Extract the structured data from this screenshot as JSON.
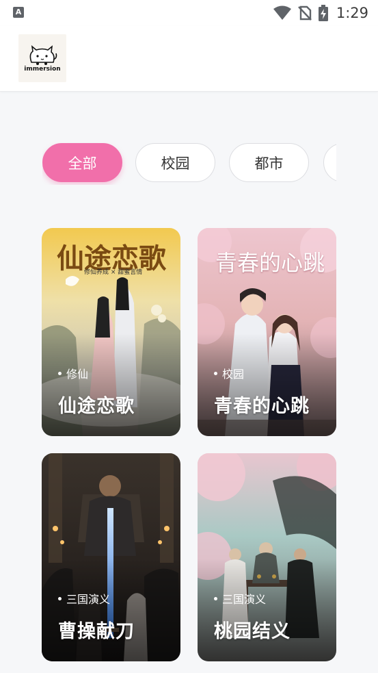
{
  "status_bar": {
    "app_icon_letter": "A",
    "time": "1:29"
  },
  "header": {
    "logo_text": "immersion"
  },
  "categories": [
    {
      "label": "全部",
      "active": true
    },
    {
      "label": "校园",
      "active": false
    },
    {
      "label": "都市",
      "active": false
    },
    {
      "label": "",
      "active": false
    }
  ],
  "stories": [
    {
      "tag": "修仙",
      "title": "仙途恋歌",
      "cover_title": "仙途恋歌",
      "cover_subtitle": "修仙养成 × 甜蜜言情"
    },
    {
      "tag": "校园",
      "title": "青春的心跳",
      "cover_title": "青春的心跳"
    },
    {
      "tag": "三国演义",
      "title": "曹操献刀"
    },
    {
      "tag": "三国演义",
      "title": "桃园结义"
    }
  ],
  "colors": {
    "accent": "#f16faa",
    "background": "#f6f7f9"
  }
}
